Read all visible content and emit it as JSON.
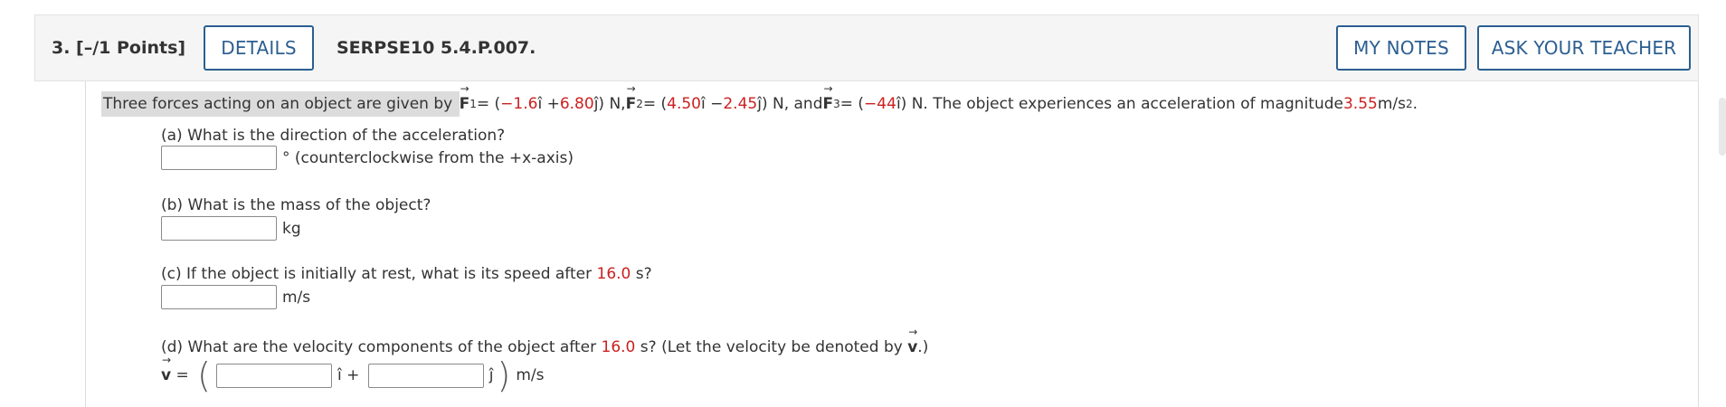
{
  "header": {
    "question_points": "3.  [–/1 Points]",
    "details_label": "DETAILS",
    "question_code": "SERPSE10 5.4.P.007.",
    "my_notes_label": "MY NOTES",
    "ask_teacher_label": "ASK YOUR TEACHER"
  },
  "statement": {
    "intro": "Three forces acting on an object are given by",
    "f1_symbol": "F",
    "f1_sub": "1",
    "f1_eq_open": " = (",
    "f1_x": "−1.6",
    "f1_i_plus": "î + ",
    "f1_y": "6.80",
    "f1_close": "ĵ) N, ",
    "f2_symbol": "F",
    "f2_sub": "2",
    "f2_eq_open": " = (",
    "f2_x": "4.50",
    "f2_i_minus": "î − ",
    "f2_y": "2.45",
    "f2_close": "ĵ) N, and ",
    "f3_symbol": "F",
    "f3_sub": "3",
    "f3_eq_open": " = (",
    "f3_x": "−44",
    "f3_close": "î) N. The object experiences an acceleration of magnitude ",
    "accel_value": "3.55",
    "accel_unit": " m/s",
    "accel_exp": "2",
    "end": "."
  },
  "parts": {
    "a_question": "(a) What is the direction of the acceleration?",
    "a_unit": "° (counterclockwise from the +x-axis)",
    "b_question": "(b) What is the mass of the object?",
    "b_unit": "kg",
    "c_question_pre": "(c) If the object is initially at rest, what is its speed after ",
    "c_time": "16.0",
    "c_question_post": " s?",
    "c_unit": "m/s",
    "d_question_pre": "(d) What are the velocity components of the object after ",
    "d_time": "16.0",
    "d_question_post": " s? (Let the velocity be denoted by ",
    "d_v_symbol": "v",
    "d_question_end": ".)",
    "d_lhs": "v",
    "d_eq": " = ",
    "d_i_plus": "î + ",
    "d_j": "ĵ",
    "d_unit": "m/s"
  },
  "colors": {
    "accent_blue": "#2c5f91",
    "value_red": "#cc2020",
    "highlight_grey": "#dcdcdc"
  }
}
